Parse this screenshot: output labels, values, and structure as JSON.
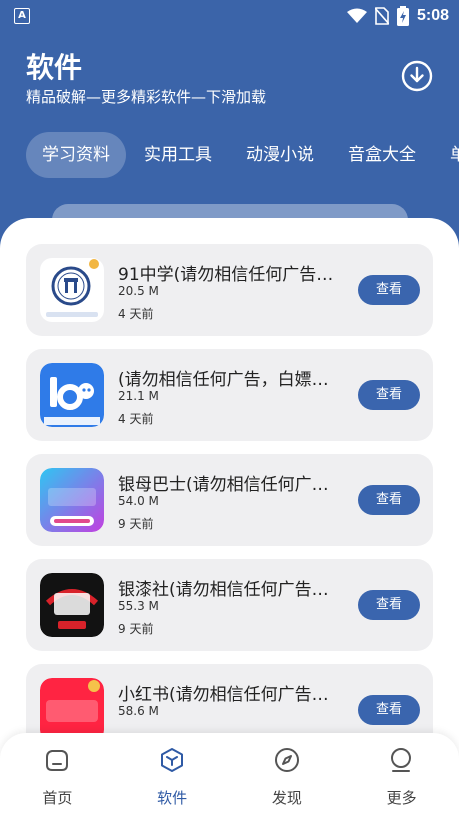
{
  "status_bar": {
    "time": "5:08",
    "notif_letter": "A"
  },
  "header": {
    "title": "软件",
    "subtitle": "精品破解—更多精彩软件—下滑加载"
  },
  "tabs": [
    "学习资料",
    "实用工具",
    "动漫小说",
    "音盒大全",
    "单"
  ],
  "apps": [
    {
      "name": "91中学(请勿相信任何广告…",
      "size": "20.5 M",
      "time": "4 天前",
      "button": "查看",
      "icon": "zhongxue-logo-icon"
    },
    {
      "name": "(请勿相信任何广告，白嫖…",
      "size": "21.1 M",
      "time": "4 天前",
      "button": "查看",
      "icon": "16-logo-icon"
    },
    {
      "name": "银母巴士(请勿相信任何广…",
      "size": "54.0 M",
      "time": "9 天前",
      "button": "查看",
      "icon": "yinmu-logo-icon"
    },
    {
      "name": "银漆社(请勿相信任何广告…",
      "size": "55.3 M",
      "time": "9 天前",
      "button": "查看",
      "icon": "yinqishe-logo-icon"
    },
    {
      "name": "小红书(请勿相信任何广告…",
      "size": "58.6 M",
      "time": "",
      "button": "查看",
      "icon": "xiaohongshu-logo-icon"
    }
  ],
  "bottom_nav": [
    {
      "label": "首页",
      "icon": "home-icon"
    },
    {
      "label": "软件",
      "icon": "cube-icon"
    },
    {
      "label": "发现",
      "icon": "compass-icon"
    },
    {
      "label": "更多",
      "icon": "profile-icon"
    }
  ],
  "colors": {
    "primary": "#3b64a9",
    "button": "#3a65ae",
    "card": "#efeff1",
    "active_nav": "#2f5aa5"
  }
}
